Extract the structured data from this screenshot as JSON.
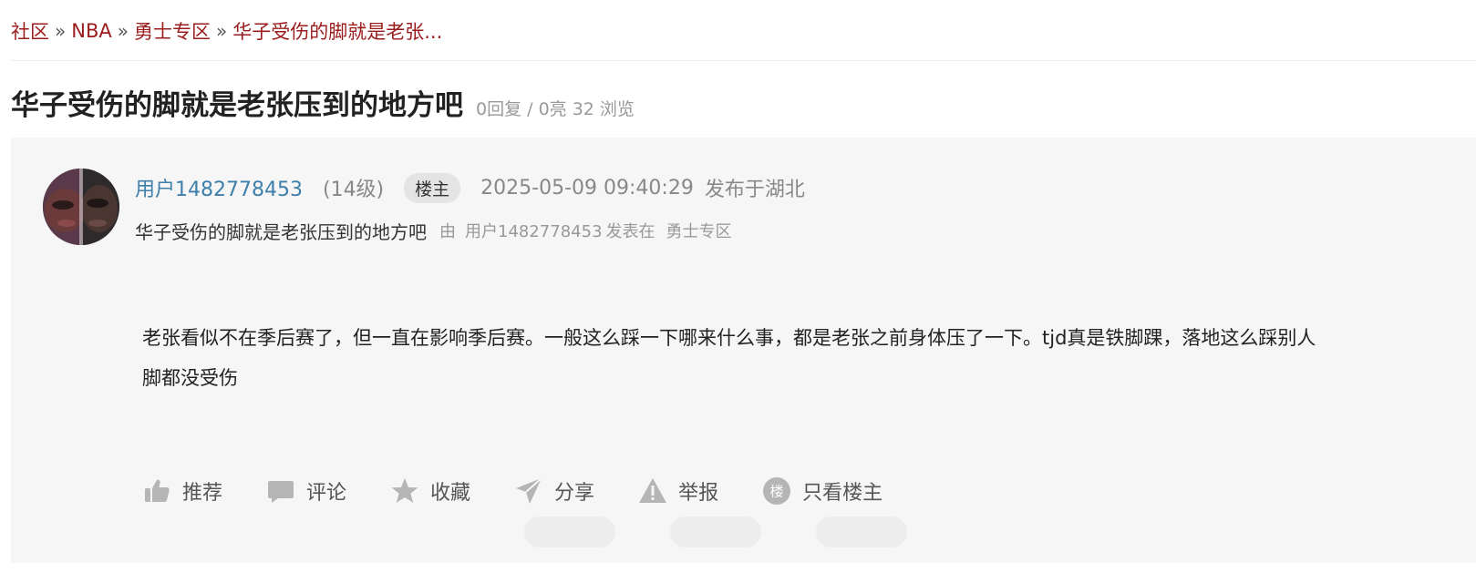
{
  "breadcrumb": {
    "items": [
      "社区",
      "NBA",
      "勇士专区",
      "华子受伤的脚就是老张..."
    ],
    "separator": "»"
  },
  "post": {
    "title": "华子受伤的脚就是老张压到的地方吧",
    "stats": "0回复 / 0亮 32 浏览",
    "author": {
      "username": "用户1482778453",
      "level": "(14级)",
      "badge": "楼主",
      "time": "2025-05-09 09:40:29",
      "location": "发布于湖北"
    },
    "subline": {
      "title": "华子受伤的脚就是老张压到的地方吧",
      "by": "由",
      "user": "用户1482778453",
      "posted_in": "发表在",
      "board": "勇士专区"
    },
    "content": "老张看似不在季后赛了，但一直在影响季后赛。一般这么踩一下哪来什么事，都是老张之前身体压了一下。tjd真是铁脚踝，落地这么踩别人脚都没受伤"
  },
  "actions": [
    {
      "label": "推荐",
      "icon": "thumbs-up-icon"
    },
    {
      "label": "评论",
      "icon": "comment-icon"
    },
    {
      "label": "收藏",
      "icon": "star-icon"
    },
    {
      "label": "分享",
      "icon": "share-icon"
    },
    {
      "label": "举报",
      "icon": "warning-icon"
    },
    {
      "label": "只看楼主",
      "icon": "op-badge-icon",
      "icon_text": "楼"
    }
  ],
  "colors": {
    "breadcrumb_link": "#9b1c1c",
    "username": "#3e7fab",
    "post_bg": "#f6f6f6",
    "icon_gray": "#b5b5b5"
  }
}
